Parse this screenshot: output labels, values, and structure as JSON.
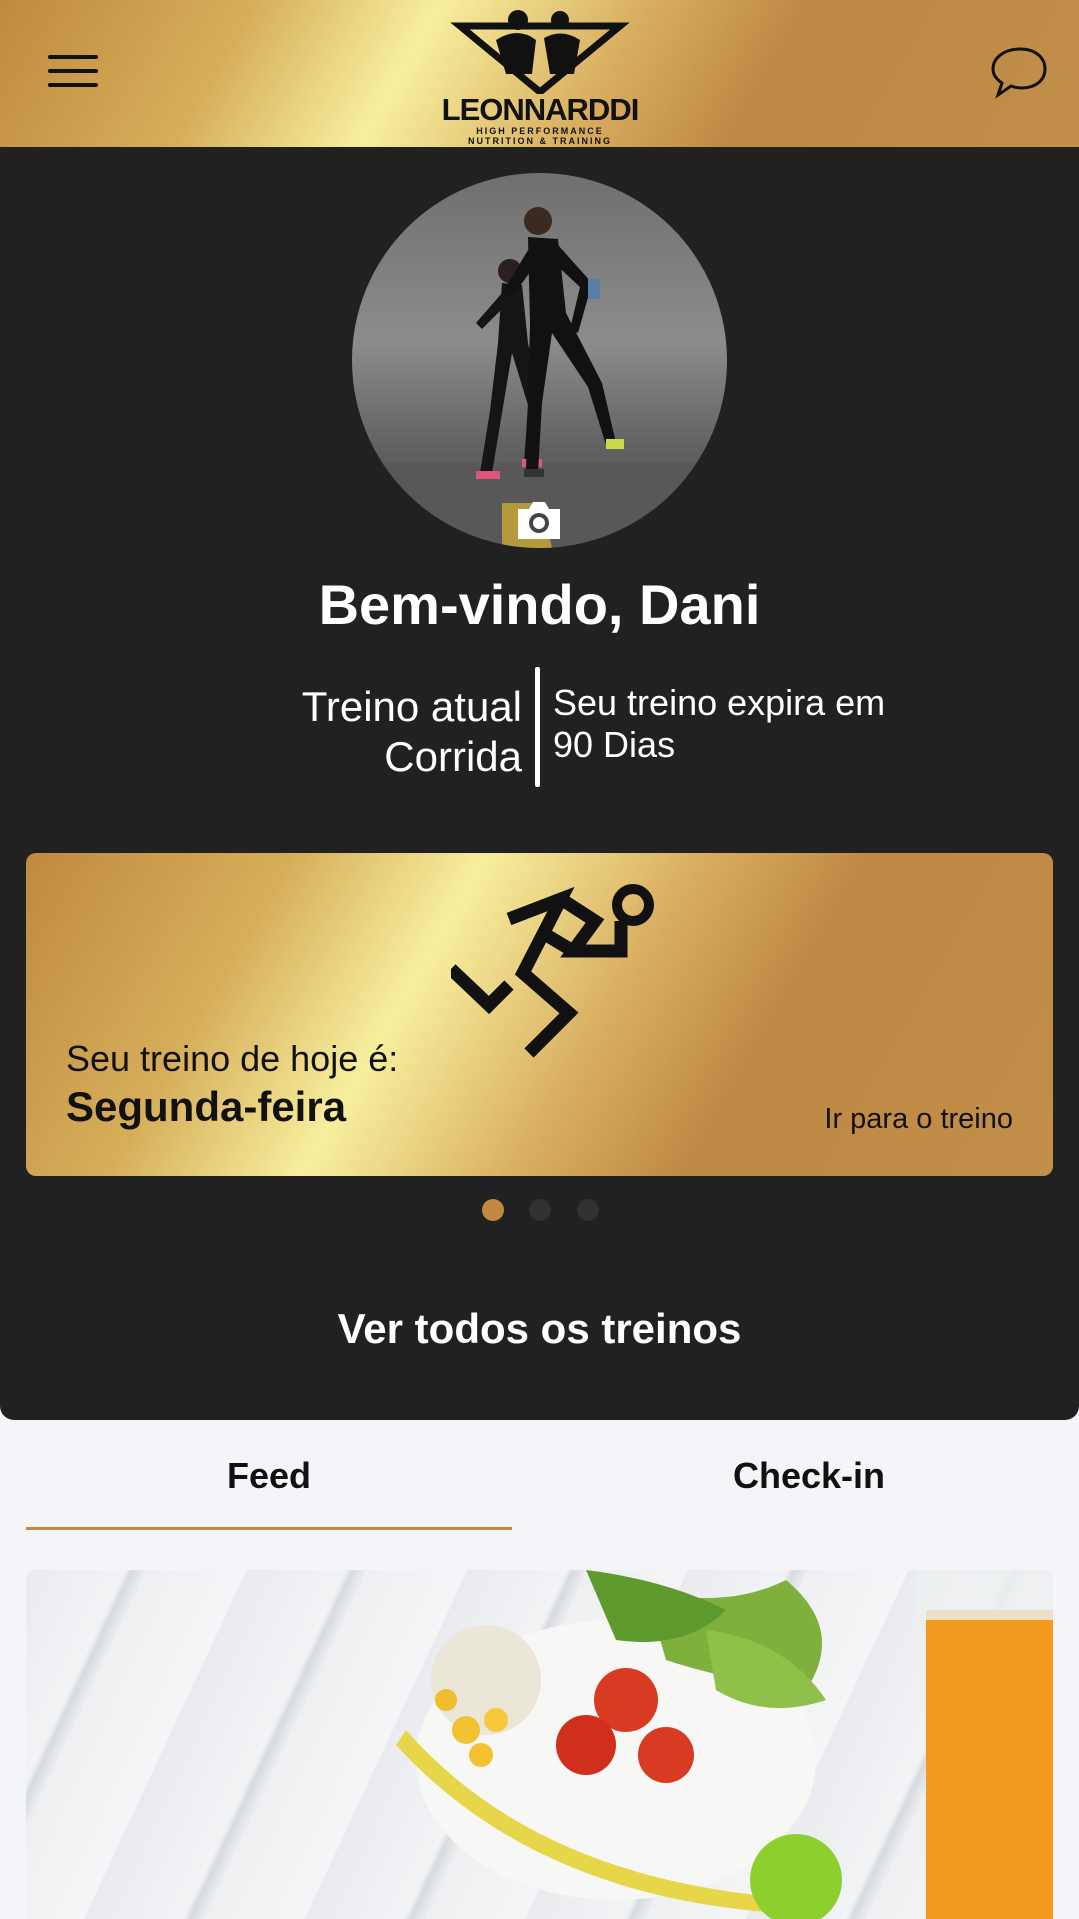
{
  "header": {
    "logo_name": "LEONNARDDI",
    "logo_tagline_1": "HIGH PERFORMANCE",
    "logo_tagline_2": "NUTRITION & TRAINING",
    "menu_icon": "hamburger-menu-icon",
    "chat_icon": "chat-bubble-icon"
  },
  "profile": {
    "welcome": "Bem-vindo, Dani",
    "current_label": "Treino atual",
    "current_value": "Corrida",
    "expires_label": "Seu treino expira em",
    "expires_value": "90 Dias",
    "camera_icon": "camera-icon"
  },
  "carousel": {
    "subtitle": "Seu treino de hoje é:",
    "day": "Segunda-feira",
    "link": "Ir para o treino",
    "icon": "running-person-icon",
    "active_index": 0,
    "count": 3
  },
  "all_trainings": "Ver todos os treinos",
  "tabs": [
    {
      "label": "Feed",
      "active": true
    },
    {
      "label": "Check-in",
      "active": false
    }
  ],
  "colors": {
    "accent": "#c08a43",
    "dark_bg": "#222122",
    "light_bg": "#f4f5f9"
  }
}
